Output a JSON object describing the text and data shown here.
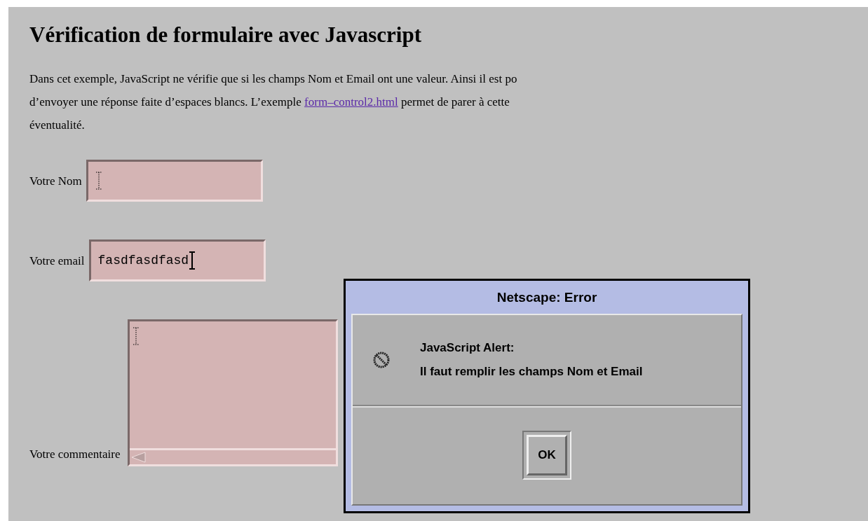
{
  "page": {
    "heading": "Vérification de formulaire avec Javascript",
    "intro": {
      "before": "Dans cet exemple, JavaScript ne vérifie que si les champs Nom et Email ont une valeur. Ainsi il est po\nd’envoyer une réponse faite d’espaces blancs. L’exemple ",
      "link": "form–control2.html",
      "after": " permet de parer à cette\néventualité."
    }
  },
  "form": {
    "fields": [
      {
        "kind": "text",
        "label": "Votre Nom"
      },
      {
        "kind": "text",
        "label": "Votre email",
        "value": "fasdfasdfasd"
      },
      {
        "kind": "textarea",
        "label": "Votre commentaire"
      }
    ]
  },
  "dialog": {
    "title": "Netscape: Error",
    "heading": "JavaScript Alert:",
    "message": "Il faut remplir les champs Nom et Email",
    "buttons": [
      "OK"
    ]
  }
}
